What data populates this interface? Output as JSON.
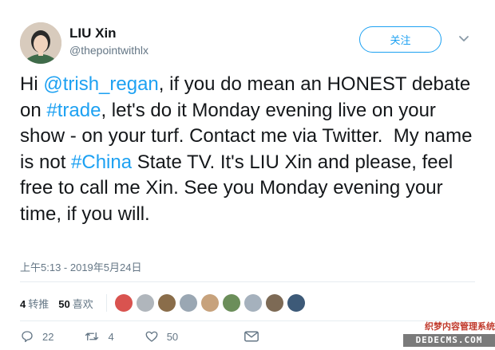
{
  "user": {
    "display_name": "LIU Xin",
    "handle": "@thepointwithlx"
  },
  "follow_label": "关注",
  "tweet": {
    "parts": [
      {
        "text": "Hi ",
        "link": false
      },
      {
        "text": "@trish_regan",
        "link": true
      },
      {
        "text": ", if you do mean an HONEST debate on ",
        "link": false
      },
      {
        "text": "#trade",
        "link": true
      },
      {
        "text": ", let's do it Monday evening live on your show - on your turf. Contact me via Twitter.  My name is not ",
        "link": false
      },
      {
        "text": "#China",
        "link": true
      },
      {
        "text": " State TV. It's LIU Xin and please, feel free to call me Xin. See you Monday evening your time, if you will.",
        "link": false
      }
    ]
  },
  "timestamp": "上午5:13 - 2019年5月24日",
  "stats": {
    "retweets_count": "4",
    "retweets_label": "转推",
    "likes_count": "50",
    "likes_label": "喜欢"
  },
  "liker_colors": [
    "#d9534f",
    "#b0b6bc",
    "#8a6d4a",
    "#9aa7b3",
    "#c7a27c",
    "#6b8e5a",
    "#a5b1bd",
    "#7d6a55",
    "#3d5a78"
  ],
  "actions": {
    "reply_count": "22",
    "retweet_count": "4",
    "like_count": "50"
  },
  "watermark": {
    "top": "织梦内容管理系统",
    "bottom": "DEDECMS.COM"
  },
  "colors": {
    "accent": "#1da1f2",
    "secondary_text": "#657786"
  }
}
